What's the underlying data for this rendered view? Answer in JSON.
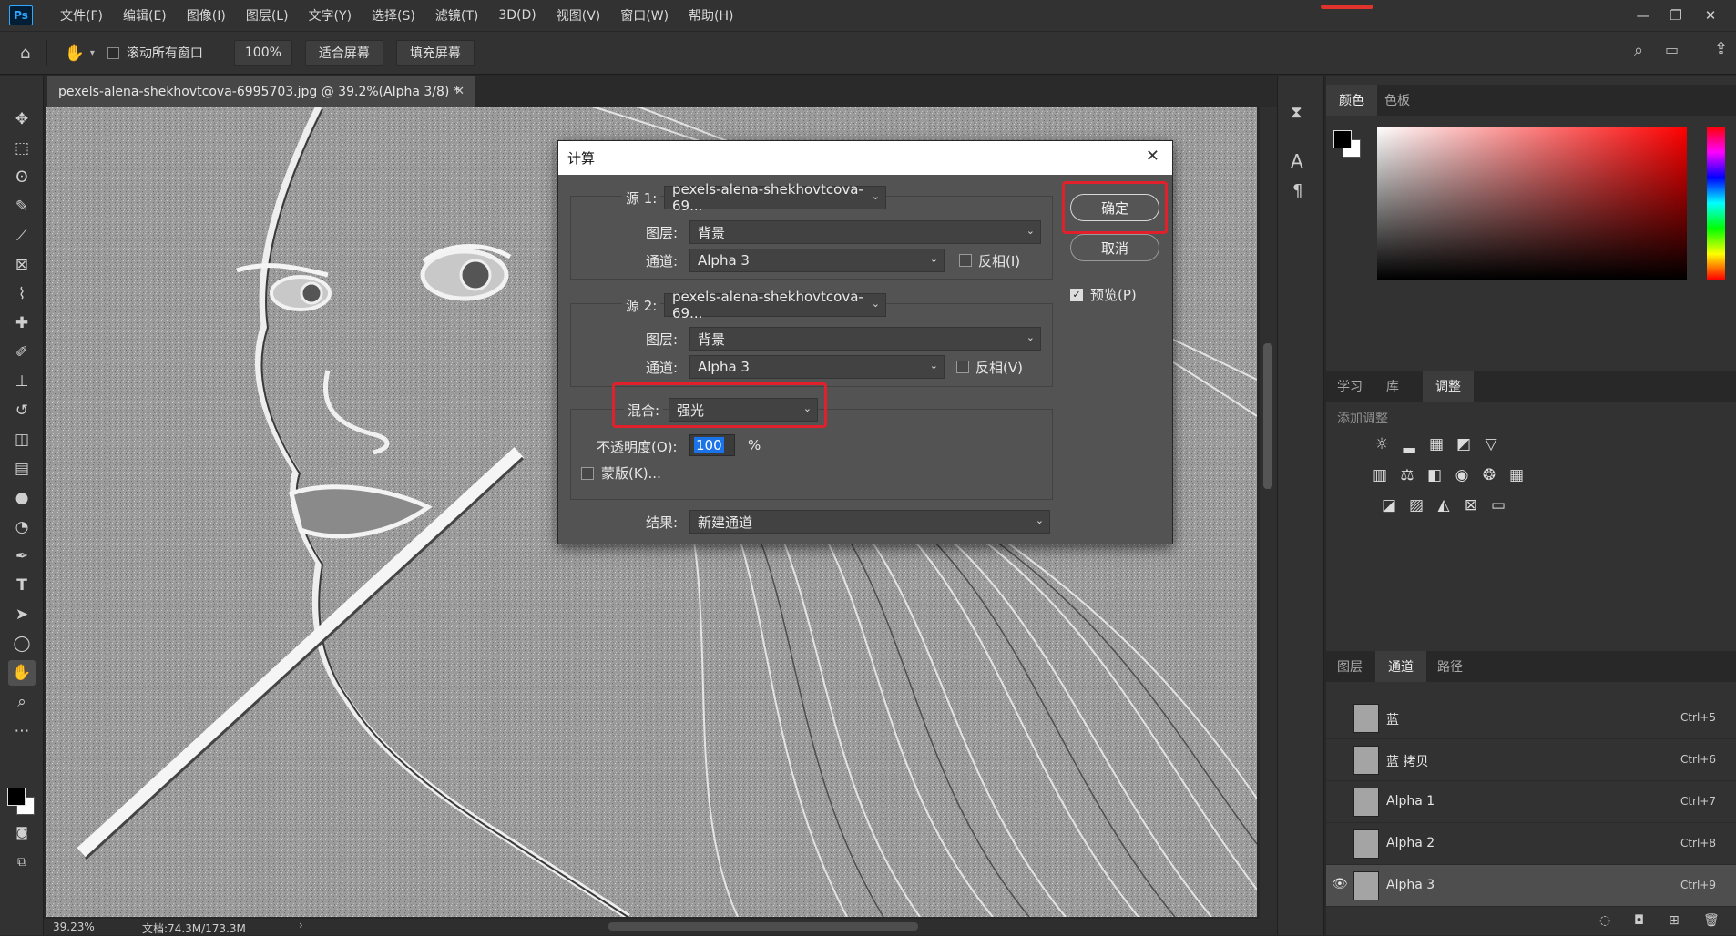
{
  "app": {
    "logo": "Ps"
  },
  "menu": [
    "文件(F)",
    "编辑(E)",
    "图像(I)",
    "图层(L)",
    "文字(Y)",
    "选择(S)",
    "滤镜(T)",
    "3D(D)",
    "视图(V)",
    "窗口(W)",
    "帮助(H)"
  ],
  "options": {
    "scroll_all": "滚动所有窗口",
    "zoom": "100%",
    "fit_screen": "适合屏幕",
    "fill_screen": "填充屏幕"
  },
  "document": {
    "tab_title": "pexels-alena-shekhovtcova-6995703.jpg @ 39.2%(Alpha 3/8) *",
    "zoom_status": "39.23%",
    "doc_status": "文档:74.3M/173.3M"
  },
  "dialog": {
    "title": "计算",
    "source1": {
      "label": "源 1:",
      "file": "pexels-alena-shekhovtcova-69...",
      "layer_label": "图层:",
      "layer": "背景",
      "channel_label": "通道:",
      "channel": "Alpha 3",
      "invert_label": "反相(I)"
    },
    "source2": {
      "label": "源 2:",
      "file": "pexels-alena-shekhovtcova-69...",
      "layer_label": "图层:",
      "layer": "背景",
      "channel_label": "通道:",
      "channel": "Alpha 3",
      "invert_label": "反相(V)"
    },
    "blend": {
      "label": "混合:",
      "mode": "强光",
      "opacity_label": "不透明度(O):",
      "opacity": "100",
      "percent": "%",
      "mask_label": "蒙版(K)..."
    },
    "result": {
      "label": "结果:",
      "value": "新建通道"
    },
    "ok": "确定",
    "cancel": "取消",
    "preview": "预览(P)"
  },
  "color_panel": {
    "tabs": [
      "颜色",
      "色板"
    ],
    "hue_color": "#ff0000"
  },
  "adjust_panel": {
    "tabs": [
      "学习",
      "库",
      "调整"
    ],
    "add_label": "添加调整"
  },
  "channels_panel": {
    "tabs": [
      "图层",
      "通道",
      "路径"
    ],
    "rows": [
      {
        "name": "蓝",
        "shortcut": "Ctrl+5"
      },
      {
        "name": "蓝 拷贝",
        "shortcut": "Ctrl+6"
      },
      {
        "name": "Alpha 1",
        "shortcut": "Ctrl+7"
      },
      {
        "name": "Alpha 2",
        "shortcut": "Ctrl+8"
      },
      {
        "name": "Alpha 3",
        "shortcut": "Ctrl+9"
      }
    ]
  }
}
